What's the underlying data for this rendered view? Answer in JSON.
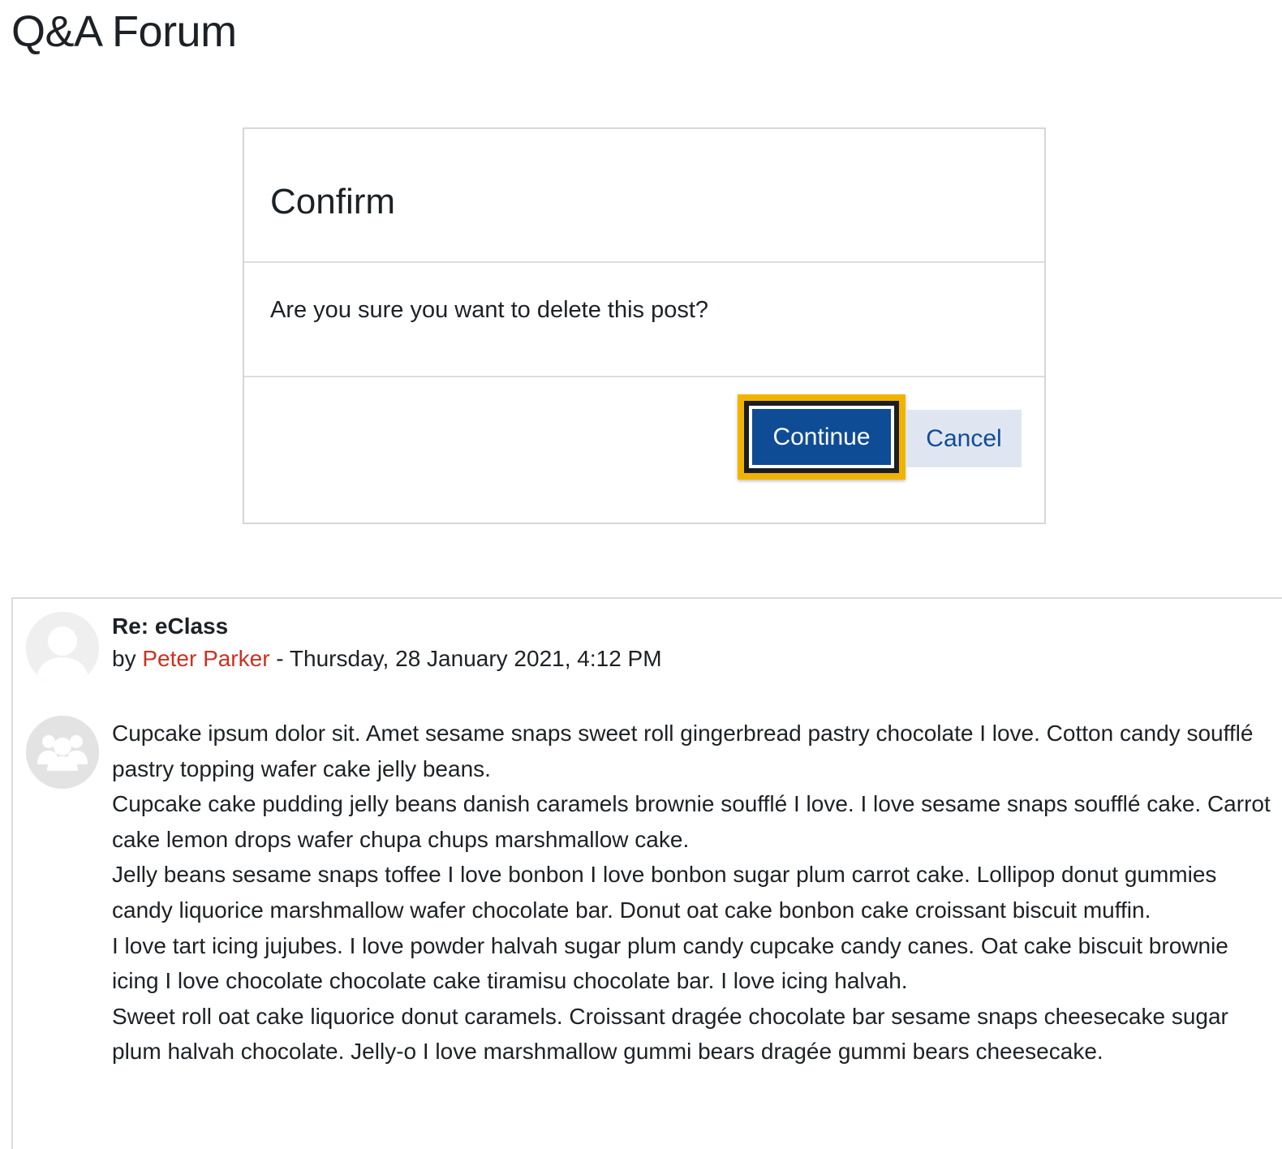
{
  "page": {
    "title": "Q&A Forum"
  },
  "dialog": {
    "title": "Confirm",
    "message": "Are you sure you want to delete this post?",
    "continue_label": "Continue",
    "cancel_label": "Cancel",
    "focused_button": "Continue"
  },
  "post": {
    "subject": "Re: eClass",
    "by_prefix": "by",
    "author": "Peter Parker",
    "date_separator": " - ",
    "date": "Thursday, 28 January 2021, 4:12 PM",
    "avatar_icon": "user-silhouette-icon",
    "group_icon": "group-people-icon",
    "paragraphs": [
      "Cupcake ipsum dolor sit. Amet sesame snaps sweet roll gingerbread pastry chocolate I love. Cotton candy soufflé pastry topping wafer cake jelly beans.",
      "Cupcake cake pudding jelly beans danish caramels brownie soufflé I love. I love sesame snaps soufflé cake. Carrot cake lemon drops wafer chupa chups marshmallow cake.",
      "Jelly beans sesame snaps toffee I love bonbon I love bonbon sugar plum carrot cake. Lollipop donut gummies candy liquorice marshmallow wafer chocolate bar. Donut oat cake bonbon cake croissant biscuit muffin.",
      "I love tart icing jujubes. I love powder halvah sugar plum candy cupcake candy canes. Oat cake biscuit brownie icing I love chocolate chocolate cake tiramisu chocolate bar. I love icing halvah.",
      "Sweet roll oat cake liquorice donut caramels. Croissant dragée chocolate bar sesame snaps cheesecake sugar plum halvah chocolate. Jelly-o I love marshmallow gummi bears dragée gummi bears cheesecake."
    ]
  },
  "colors": {
    "primary": "#0f4c96",
    "secondary_bg": "#e0e6f1",
    "focus_ring": "#f0b400",
    "author_link": "#ca3120",
    "text": "#1d2125",
    "border": "#d6d6d6"
  }
}
